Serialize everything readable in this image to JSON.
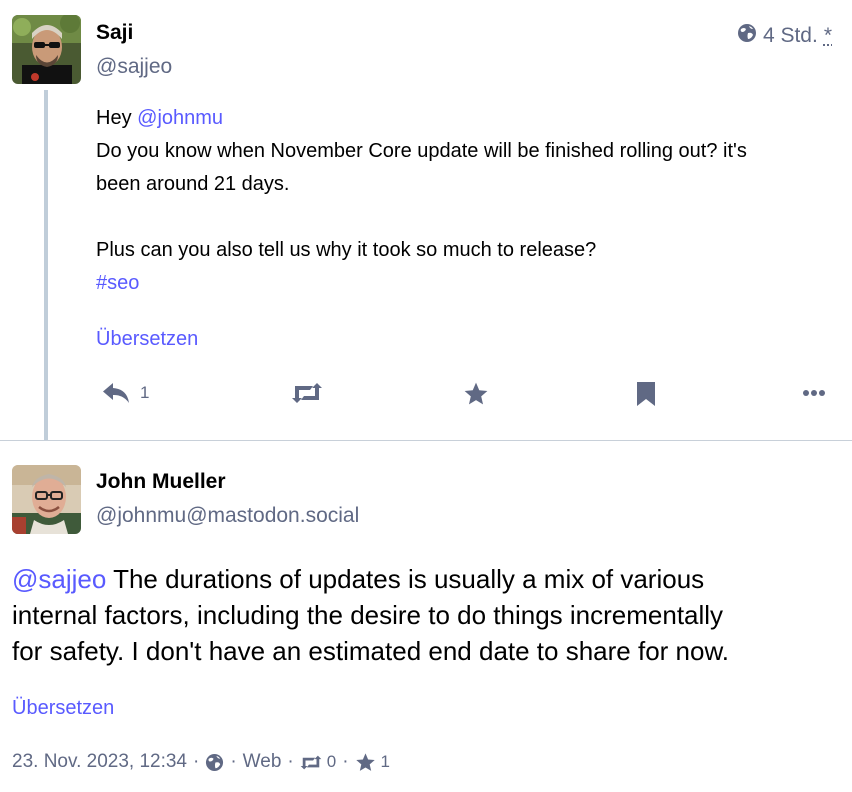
{
  "parent_status": {
    "display_name": "Saji",
    "acct": "@sajjeo",
    "relative_time": "4 Std.",
    "edited_marker": "*",
    "visibility_icon": "globe-icon",
    "mention": "@johnmu",
    "greeting": "Hey",
    "line1": "Do you know when November Core update will be finished rolling out? it's",
    "line2": "been around 21 days.",
    "line3": "Plus can you also tell us why it took so much to release?",
    "hashtag": "#seo",
    "translate_label": "Übersetzen",
    "actions": {
      "reply_count": "1",
      "reply_icon": "reply-icon",
      "boost_icon": "boost-icon",
      "favourite_icon": "star-icon",
      "bookmark_icon": "bookmark-icon",
      "more_icon": "ellipsis-icon"
    }
  },
  "detail_status": {
    "display_name": "John Mueller",
    "acct": "@johnmu@mastodon.social",
    "mention": "@sajjeo",
    "text_line1": " The durations of updates is usually a mix of various",
    "text_line2": "internal factors, including the desire to do things incrementally",
    "text_line3": "for safety. I don't have an estimated end date to share for now.",
    "translate_label": "Übersetzen",
    "meta": {
      "datetime": "23. Nov. 2023, 12:34",
      "separator": "·",
      "application": "Web",
      "boost_count": "0",
      "favourite_count": "1"
    }
  },
  "colors": {
    "link": "#595aff",
    "muted": "#606984",
    "thread_line": "#c0cdd9",
    "divider": "#c8d0d9"
  }
}
